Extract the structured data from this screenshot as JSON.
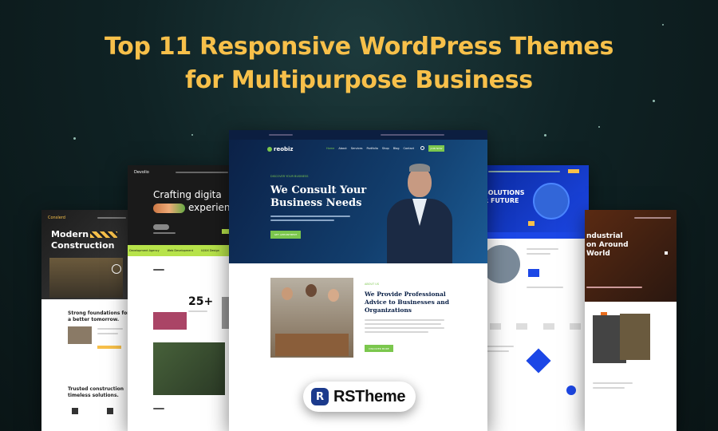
{
  "headline": {
    "line1": "Top 11 Responsive WordPress Themes",
    "line2": "for Multipurpose Business"
  },
  "brand": {
    "name": "RSTheme",
    "logo_letter": "R",
    "color": "#1b3a8c"
  },
  "colors": {
    "headline": "#f7c04a",
    "background": "#0e1c1e",
    "accent_green": "#7bc74d"
  },
  "card_left_outer": {
    "logo": "Conslerd",
    "hero_line1": "Modern",
    "hero_line2": "Construction",
    "heading1": "Strong foundations for",
    "heading2": "a better tomorrow.",
    "bottom1": "Trusted construction",
    "bottom2": "timeless solutions."
  },
  "card_left_inner": {
    "logo": "Devolio",
    "hero_line1": "Crafting digita",
    "hero_line2": "experien",
    "tab1": "Development Agency",
    "tab2": "Web Development",
    "tab3": "UI/UX Design",
    "stat": "25+"
  },
  "card_center": {
    "logo": "reobiz",
    "nav": [
      "Home",
      "About",
      "Services",
      "Portfolio",
      "Shop",
      "Blog",
      "Contact"
    ],
    "nav_button": "JOIN NOW",
    "eyebrow": "DISCOVER YOUR BUSINESS",
    "hero_line1": "We Consult Your",
    "hero_line2": "Business Needs",
    "hero_button": "GET APPOINTMENT",
    "section_eyebrow": "ABOUT US",
    "section_line1": "We Provide Professional",
    "section_line2": "Advice to Businesses and",
    "section_line3": "Organizations",
    "section_button": "DISCOVER MORE"
  },
  "card_right_inner": {
    "hero_line1": "SOLUTIONS",
    "hero_line2": "R FUTURE"
  },
  "card_right_outer": {
    "hero_line1": "ndustrial",
    "hero_line2": "on Around",
    "hero_line3": "World"
  }
}
